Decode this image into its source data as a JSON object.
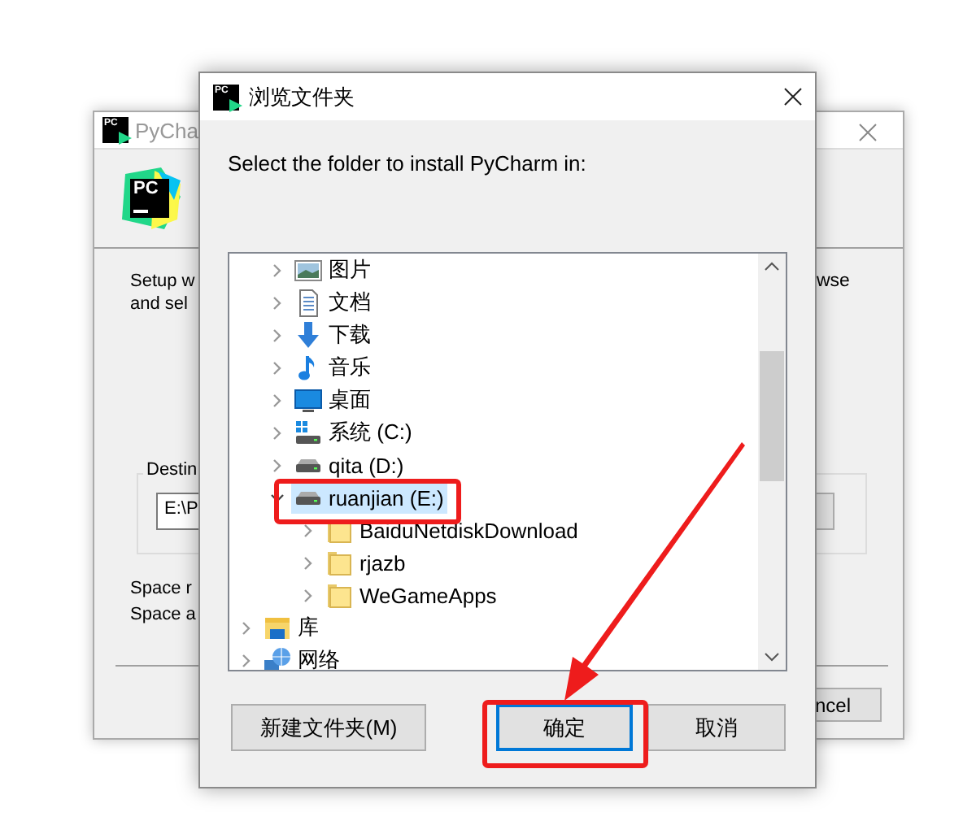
{
  "background_window": {
    "icon_text": "PC",
    "title": "PyCha",
    "logo_text": "PC",
    "intro": [
      "Setup w",
      "and sel"
    ],
    "intro_right": "wse",
    "group_label": "Destin",
    "path_field": "E:\\P",
    "space": [
      "Space r",
      "Space a"
    ],
    "cancel": "ncel"
  },
  "dialog": {
    "icon_text": "PC",
    "title": "浏览文件夹",
    "prompt": "Select the folder to install PyCharm in:",
    "tree": [
      {
        "children": [
          {
            "label": "图片",
            "kind": "pictures",
            "expanded": false,
            "selected": false
          },
          {
            "label": "文档",
            "kind": "documents",
            "expanded": false,
            "selected": false
          },
          {
            "label": "下载",
            "kind": "downloads",
            "expanded": false,
            "selected": false
          },
          {
            "label": "音乐",
            "kind": "music",
            "expanded": false,
            "selected": false
          },
          {
            "label": "桌面",
            "kind": "desktop",
            "expanded": false,
            "selected": false
          },
          {
            "label": "系统 (C:)",
            "kind": "system-drive",
            "expanded": false,
            "selected": false
          },
          {
            "label": "qita (D:)",
            "kind": "drive",
            "expanded": false,
            "selected": false
          },
          {
            "label": "ruanjian (E:)",
            "kind": "drive",
            "expanded": true,
            "selected": true,
            "children": [
              {
                "label": "BaiduNetdiskDownload",
                "kind": "folder",
                "expanded": false,
                "selected": false
              },
              {
                "label": "rjazb",
                "kind": "folder",
                "expanded": false,
                "selected": false
              },
              {
                "label": "WeGameApps",
                "kind": "folder",
                "expanded": false,
                "selected": false
              }
            ]
          }
        ]
      },
      {
        "label": "库",
        "kind": "library",
        "expanded": false,
        "selected": false
      },
      {
        "label": "网络",
        "kind": "network",
        "expanded": false,
        "selected": false
      }
    ],
    "buttons": [
      {
        "label": "新建文件夹(M)",
        "focused": false
      },
      {
        "label": "确定",
        "focused": true
      },
      {
        "label": "取消",
        "focused": false
      }
    ]
  }
}
